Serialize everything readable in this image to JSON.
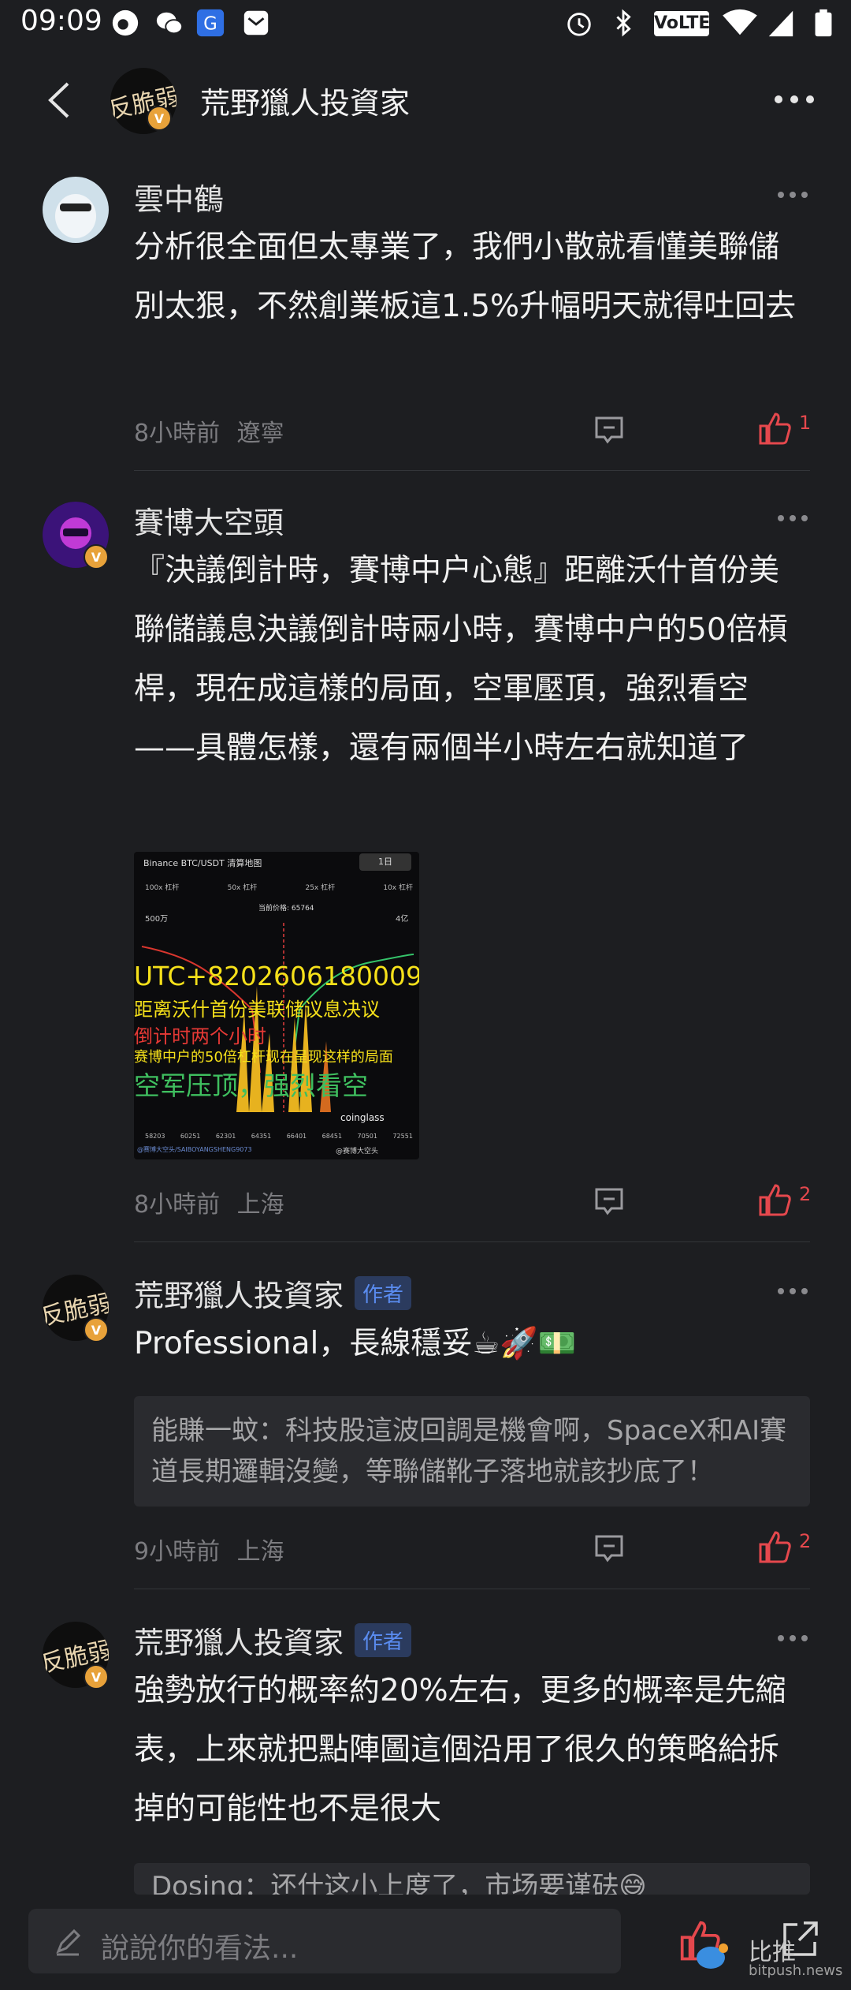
{
  "status_bar": {
    "time": "09:09",
    "volte": "VoLTE"
  },
  "header": {
    "title": "荒野獵人投資家",
    "avatar_text": "反脆弱"
  },
  "comments": [
    {
      "user": "雲中鶴",
      "text": "分析很全面但太專業了，我們小散就看懂美聯儲別太狠，不然創業板這1.5%升幅明天就得吐回去",
      "time": "8小時前",
      "location": "遼寧",
      "likes": "1"
    },
    {
      "user": "賽博大空頭",
      "text": "『決議倒計時，賽博中户心態』距離沃什首份美聯儲議息決議倒計時兩小時，賽博中户的50倍槓桿，現在成這樣的局面，空軍壓頂，強烈看空——具體怎樣，還有兩個半小時左右就知道了",
      "time": "8小時前",
      "location": "上海",
      "likes": "2",
      "image": {
        "header": "Binance BTC/USDT 清算地图",
        "interval": "1日",
        "legend": [
          "100x 杠杆",
          "50x 杠杆",
          "25x 杠杆",
          "10x 杠杆"
        ],
        "price_label": "当前价格: 65764",
        "left_top": "500万",
        "right_top": "4亿",
        "caption_1": "UTC+8202606180009",
        "caption_2": "距离沃什首份美联储议息决议",
        "caption_3": "倒计时两个小时",
        "caption_4": "赛博中户的50倍杠杆现在呈现这样的局面",
        "caption_5": "空军压顶，强烈看空",
        "watermark": "coinglass",
        "x_ticks": [
          "58203",
          "60251",
          "62301",
          "64351",
          "66401",
          "68451",
          "70501",
          "72551"
        ],
        "footer_left": "@赛博大空头/SAIBOYANGSHENG9073",
        "footer_right": "@赛博大空头"
      }
    },
    {
      "user": "荒野獵人投資家",
      "author_tag": "作者",
      "avatar_text": "反脆弱",
      "text": "Professional，長線穩妥",
      "emojis": [
        "☕",
        "🚀",
        "💵"
      ],
      "quote": "能賺一蚊：科技股這波回調是機會啊，SpaceX和AI賽道長期邏輯沒變，等聯儲靴子落地就該抄底了！",
      "time": "9小時前",
      "location": "上海",
      "likes": "2"
    },
    {
      "user": "荒野獵人投資家",
      "author_tag": "作者",
      "avatar_text": "反脆弱",
      "text": "強勢放行的概率約20%左右，更多的概率是先縮表，上來就把點陣圖這個沿用了很久的策略給拆掉的可能性也不是很大",
      "partial_quote": "Dosing：还什这小上度了，市场要谨砝😅"
    }
  ],
  "bottom": {
    "placeholder": "說說你的看法...",
    "watermark_cn": "比推",
    "watermark_en": "bitpush.news"
  },
  "colors": {
    "background": "#1d1e21",
    "accent_like": "#e5484d",
    "author_tag": "#5a8cf0"
  }
}
